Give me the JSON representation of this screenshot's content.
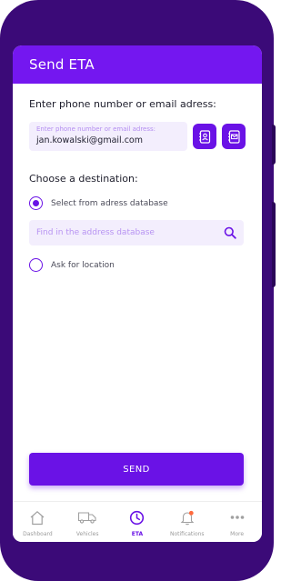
{
  "header": {
    "title": "Send ETA"
  },
  "contact": {
    "label": "Enter phone number or email adress:",
    "placeholder": "Enter phone number or email adress:",
    "value": "jan.kowalski@gmail.com",
    "buttons": {
      "contacts_icon": "address-book-icon",
      "mail_icon": "mail-contact-icon"
    }
  },
  "destination": {
    "label": "Choose a destination:",
    "options": [
      {
        "label": "Select from adress database",
        "selected": true
      },
      {
        "label": "Ask for location",
        "selected": false
      }
    ],
    "search": {
      "placeholder": "Find in the address database",
      "icon": "search-icon"
    }
  },
  "send": {
    "label": "SEND"
  },
  "tabbar": {
    "tabs": [
      {
        "label": "Dashboard",
        "icon": "home-icon",
        "active": false
      },
      {
        "label": "Vehicles",
        "icon": "van-icon",
        "active": false
      },
      {
        "label": "ETA",
        "icon": "clock-icon",
        "active": true
      },
      {
        "label": "Notifications",
        "icon": "bell-icon",
        "active": false
      },
      {
        "label": "More",
        "icon": "more-dots-icon",
        "active": false
      }
    ]
  },
  "colors": {
    "accent": "#6a12e6",
    "header": "#7417f0",
    "frame": "#3b0a78",
    "field_bg": "#f3eefd",
    "notification_dot": "#ff6a3d"
  }
}
